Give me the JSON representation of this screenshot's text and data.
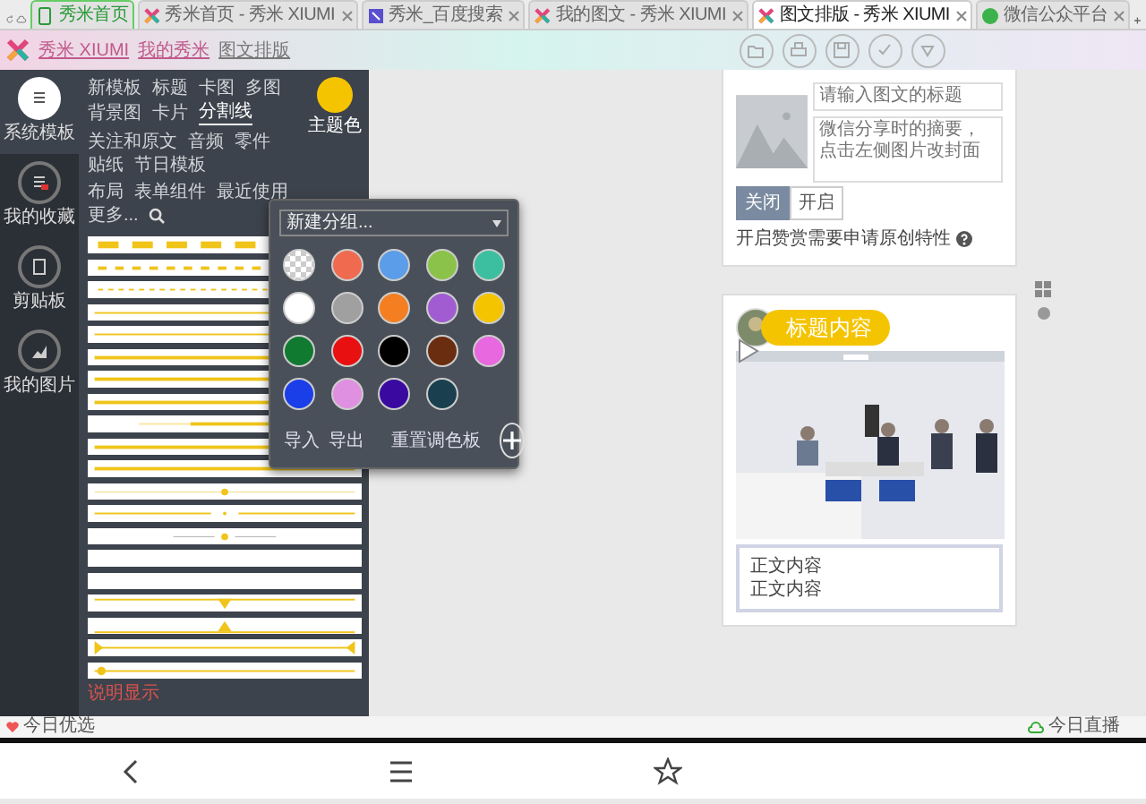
{
  "browser_tabs": [
    {
      "label": "秀米首页",
      "kind": "pinned",
      "selected": false
    },
    {
      "label": "秀米首页 - 秀米 XIUMI",
      "kind": "xiumi",
      "selected": false
    },
    {
      "label": "秀米_百度搜索",
      "kind": "search",
      "selected": false
    },
    {
      "label": "我的图文 - 秀米 XIUMI",
      "kind": "xiumi",
      "selected": false
    },
    {
      "label": "图文排版 - 秀米 XIUMI",
      "kind": "xiumi",
      "selected": true
    },
    {
      "label": "微信公众平台",
      "kind": "wechat",
      "selected": false
    }
  ],
  "breadcrumb": [
    "秀米 XIUMI",
    "我的秀米",
    "图文排版"
  ],
  "rail": [
    {
      "label": "系统模板",
      "selected": true
    },
    {
      "label": "我的收藏",
      "selected": false
    },
    {
      "label": "剪贴板",
      "selected": false
    },
    {
      "label": "我的图片",
      "selected": false
    }
  ],
  "category_rows": [
    [
      {
        "label": "新模板",
        "selected": false
      },
      {
        "label": "标题",
        "selected": false
      },
      {
        "label": "卡图",
        "selected": false
      },
      {
        "label": "多图",
        "selected": false
      },
      {
        "label": "背景图",
        "selected": false
      },
      {
        "label": "卡片",
        "selected": false
      },
      {
        "label": "分割线",
        "selected": true
      }
    ],
    [
      {
        "label": "关注和原文",
        "selected": false
      },
      {
        "label": "音频",
        "selected": false
      },
      {
        "label": "零件",
        "selected": false
      },
      {
        "label": "贴纸",
        "selected": false
      },
      {
        "label": "节日模板",
        "selected": false
      }
    ],
    [
      {
        "label": "布局",
        "selected": false
      },
      {
        "label": "表单组件",
        "selected": false
      },
      {
        "label": "最近使用",
        "selected": false
      },
      {
        "label": "更多...",
        "selected": false
      }
    ]
  ],
  "theme_color": {
    "label": "主题色",
    "color": "#f5c400"
  },
  "dividers": [
    {
      "kind": "blocks"
    },
    {
      "kind": "dashes"
    },
    {
      "kind": "dash-dot"
    },
    {
      "kind": "thin"
    },
    {
      "kind": "thin"
    },
    {
      "kind": "thick"
    },
    {
      "kind": "thick"
    },
    {
      "kind": "thick"
    },
    {
      "kind": "fade"
    },
    {
      "kind": "thick"
    },
    {
      "kind": "thick"
    },
    {
      "kind": "dot-center"
    },
    {
      "kind": "gap-dot"
    },
    {
      "kind": "dot-short"
    },
    {
      "kind": "plain"
    },
    {
      "kind": "plain"
    },
    {
      "kind": "arrow-down"
    },
    {
      "kind": "arrow-up"
    },
    {
      "kind": "end-triangles"
    },
    {
      "kind": "start-dot"
    }
  ],
  "footer_link": "说明显示",
  "palette": {
    "group_select": "新建分组...",
    "swatches": [
      {
        "kind": "transparent"
      },
      {
        "kind": "solid",
        "color": "#f06a50"
      },
      {
        "kind": "solid",
        "color": "#5b9de8"
      },
      {
        "kind": "solid",
        "color": "#8bc34a"
      },
      {
        "kind": "solid",
        "color": "#3cbfa0"
      },
      {
        "kind": "solid",
        "color": "#ffffff"
      },
      {
        "kind": "solid",
        "color": "#a0a0a0"
      },
      {
        "kind": "solid",
        "color": "#f57f20"
      },
      {
        "kind": "solid",
        "color": "#a05cd0"
      },
      {
        "kind": "solid",
        "color": "#f5c400"
      },
      {
        "kind": "solid",
        "color": "#107a30"
      },
      {
        "kind": "solid",
        "color": "#e81010"
      },
      {
        "kind": "solid",
        "color": "#000000"
      },
      {
        "kind": "solid",
        "color": "#6a2d10"
      },
      {
        "kind": "solid",
        "color": "#e868e0"
      },
      {
        "kind": "solid",
        "color": "#1a3ee8"
      },
      {
        "kind": "solid",
        "color": "#e090e0"
      },
      {
        "kind": "solid",
        "color": "#3a0aa0"
      },
      {
        "kind": "solid",
        "color": "#1a4050"
      }
    ],
    "actions": [
      "导入",
      "导出",
      "重置调色板"
    ]
  },
  "article_settings": {
    "title_placeholder": "请输入图文的标题",
    "summary_placeholder": "微信分享时的摘要，点击左侧图片改封面",
    "toggle": [
      {
        "label": "关闭",
        "selected": true
      },
      {
        "label": "开启",
        "selected": false
      }
    ],
    "note": "开启赞赏需要申请原创特性"
  },
  "article": {
    "heading": "标题内容",
    "body_lines": [
      "正文内容",
      "正文内容"
    ]
  },
  "status_bar": {
    "left": "今日优选",
    "right": "今日直播"
  }
}
